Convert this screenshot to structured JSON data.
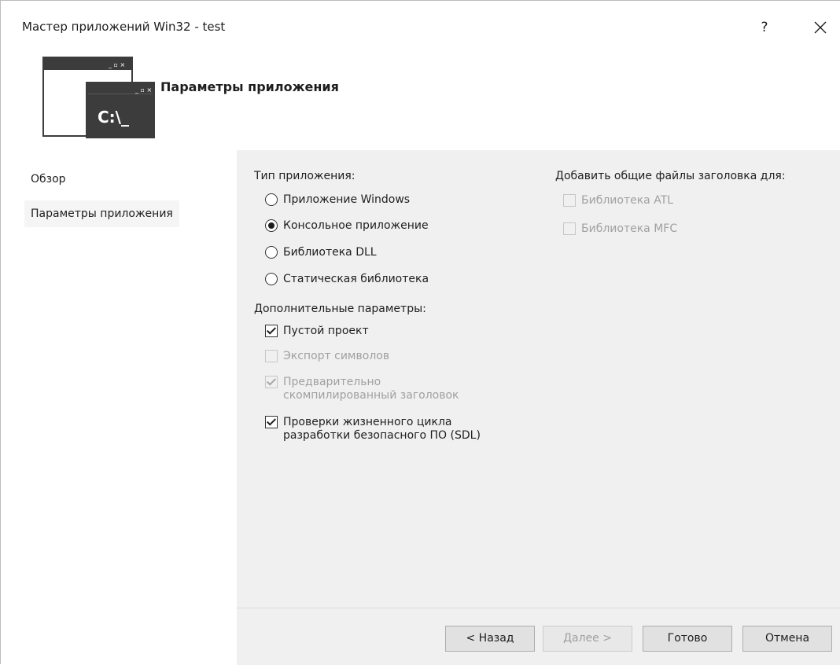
{
  "window": {
    "title": "Мастер приложений Win32 - test",
    "help_label": "?"
  },
  "header": {
    "icon_text": "C:\\_",
    "title": "Параметры приложения"
  },
  "sidebar": {
    "items": [
      {
        "label": "Обзор"
      },
      {
        "label": "Параметры приложения"
      }
    ]
  },
  "app_type": {
    "label": "Тип приложения:",
    "options": [
      {
        "label": "Приложение Windows",
        "selected": false
      },
      {
        "label": "Консольное приложение",
        "selected": true
      },
      {
        "label": "Библиотека DLL",
        "selected": false
      },
      {
        "label": "Статическая библиотека",
        "selected": false
      }
    ]
  },
  "extra_options": {
    "label": "Дополнительные параметры:",
    "options": [
      {
        "label": "Пустой проект",
        "checked": true,
        "enabled": true
      },
      {
        "label": "Экспорт символов",
        "checked": false,
        "enabled": false
      },
      {
        "label_line1": "Предварительно",
        "label_line2": "скомпилированный заголовок",
        "checked": true,
        "enabled": false
      },
      {
        "label_line1": "Проверки жизненного цикла",
        "label_line2": "разработки безопасного ПО (SDL)",
        "checked": true,
        "enabled": true
      }
    ]
  },
  "headers": {
    "label": "Добавить общие файлы заголовка для:",
    "options": [
      {
        "label": "Библиотека ATL",
        "checked": false,
        "enabled": false
      },
      {
        "label": "Библиотека MFC",
        "checked": false,
        "enabled": false
      }
    ]
  },
  "buttons": {
    "back": "< Назад",
    "next": "Далее >",
    "finish": "Готово",
    "cancel": "Отмена"
  }
}
